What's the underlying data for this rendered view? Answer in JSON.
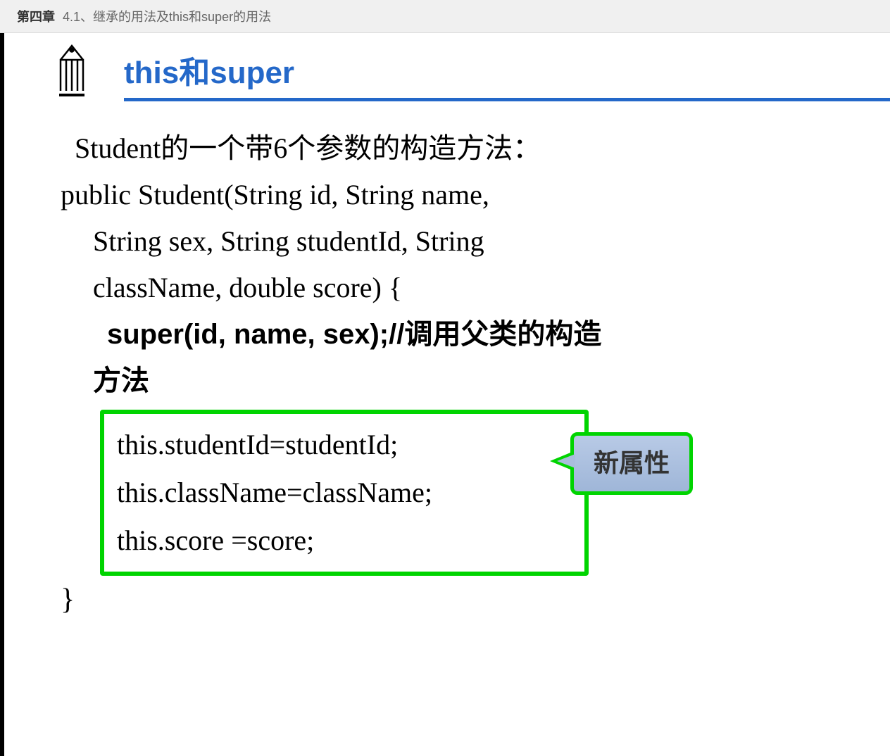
{
  "header": {
    "chapter": "第四章",
    "section": "4.1、继承的用法及this和super的用法"
  },
  "slide": {
    "title": "this和super",
    "intro": "Student的一个带6个参数的构造方法：",
    "code_line1": "public Student(String id, String name,",
    "code_line2": "String sex, String studentId, String",
    "code_line3": "className, double score) {",
    "code_super_bold": "super(id, name, sex);",
    "code_super_comment": "//调用父类的构造",
    "code_super_comment2": "方法",
    "box_line1": "this.studentId=studentId;",
    "box_line2": "this.className=className;",
    "box_line3": "this.score =score;",
    "brace_close": "}",
    "callout_label": "新属性"
  },
  "icons": {
    "pencil": "pencil-icon"
  }
}
